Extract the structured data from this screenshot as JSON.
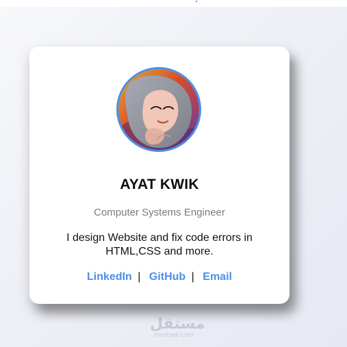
{
  "profile": {
    "name": "AYAT KWIK",
    "title": "Computer Systems Engineer",
    "bio": "I design Website and fix code errors in HTML,CSS and more."
  },
  "links": [
    {
      "label": "LinkedIn"
    },
    {
      "label": "GitHub"
    },
    {
      "label": "Email"
    }
  ],
  "link_separator": "|",
  "watermark": {
    "arabic": "مستقل",
    "latin": "mostaql.com"
  },
  "colors": {
    "accent": "#4a8fe7",
    "card_bg": "#ffffff",
    "page_bg": "#eef0f6",
    "subtitle": "#7b7b7b"
  }
}
